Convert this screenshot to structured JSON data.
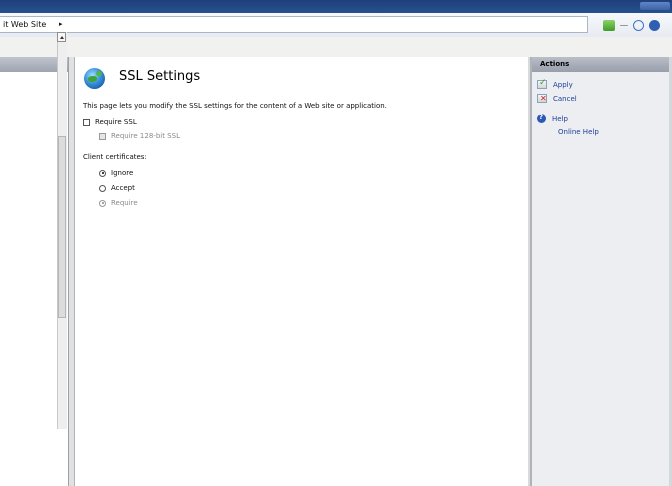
{
  "address": {
    "path_text": "it Web Site",
    "arrow": "▸"
  },
  "main": {
    "title": "SSL Settings",
    "description": "This page lets you modify the SSL settings for the content of a Web site or application.",
    "require_ssl_label": "Require SSL",
    "require_ssl_checked": false,
    "require_128_label": "Require 128-bit SSL",
    "require_128_enabled": false,
    "client_certificates_label": "Client certificates:",
    "client_cert_options": [
      {
        "label": "Ignore",
        "selected": true,
        "enabled": true
      },
      {
        "label": "Accept",
        "selected": false,
        "enabled": true
      },
      {
        "label": "Require",
        "selected": false,
        "enabled": false
      }
    ]
  },
  "actions": {
    "title": "Actions",
    "items": [
      {
        "label": "Apply",
        "icon": "apply-icon"
      },
      {
        "label": "Cancel",
        "icon": "cancel-icon"
      },
      {
        "label": "Help",
        "icon": "help-icon"
      },
      {
        "label": "Online Help",
        "icon": ""
      }
    ]
  },
  "colors": {
    "title_bar": "#1f3f7a",
    "action_link": "#1f3f9a",
    "actions_bg": "#eceef1"
  }
}
